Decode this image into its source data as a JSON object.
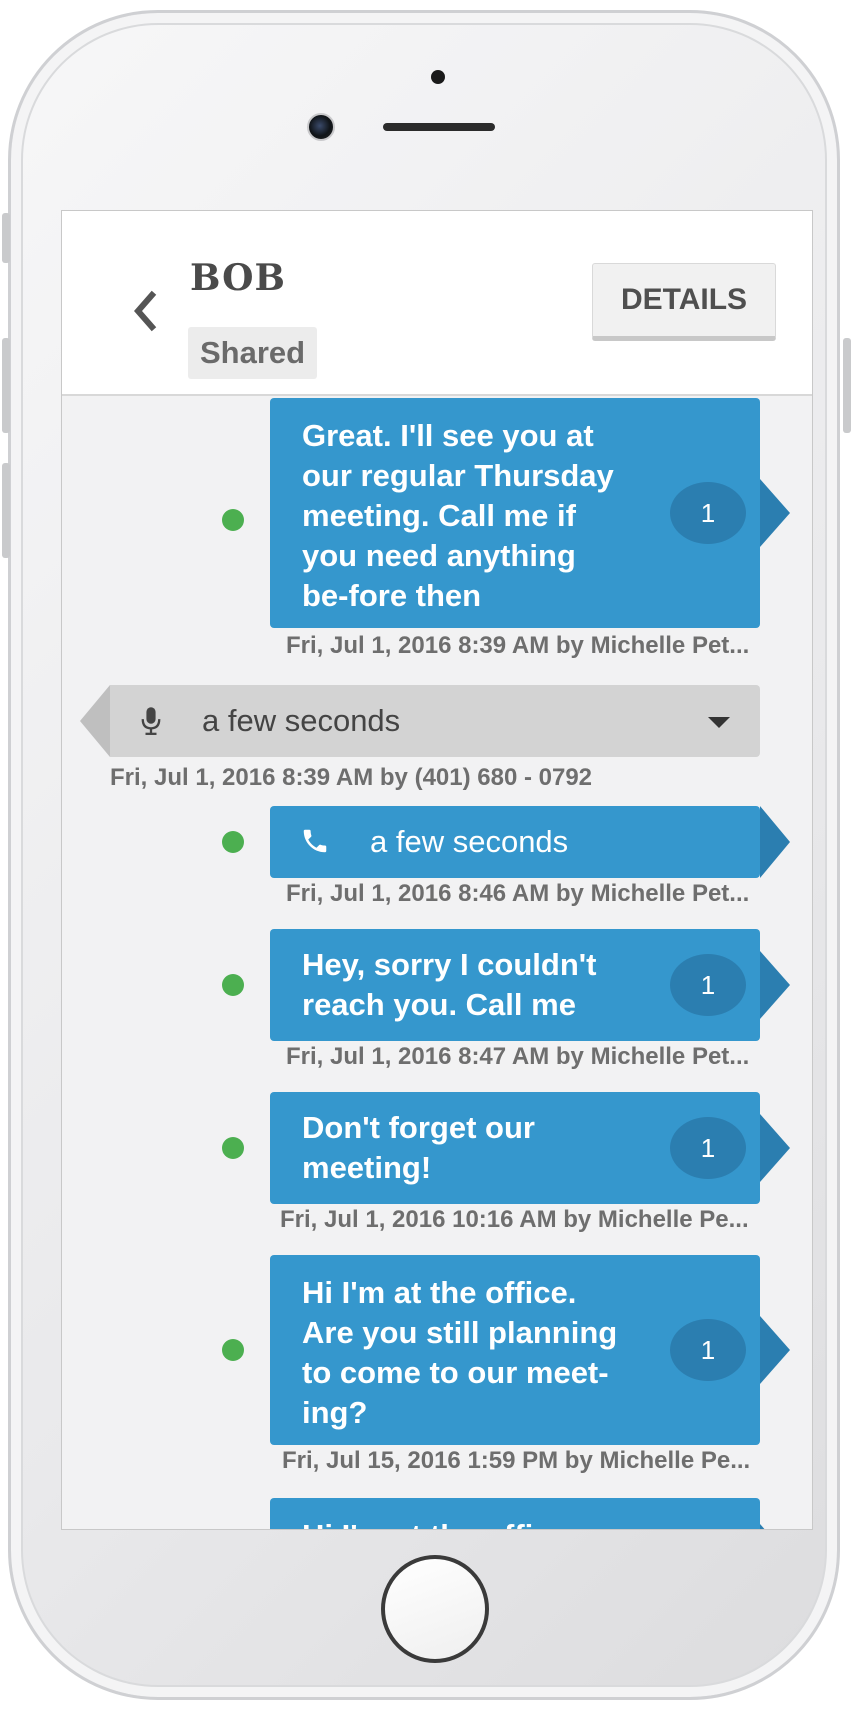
{
  "header": {
    "contact_name": "BOB",
    "badge": "Shared",
    "details_label": "DETAILS"
  },
  "messages": [
    {
      "text": "Great. I'll see you at our regular Thursday meeting. Call me if you need anything be-fore then",
      "count": "1",
      "meta": "Fri, Jul 1, 2016 8:39 AM by Michelle Pet..."
    },
    {
      "type": "voicemail",
      "label": "a few seconds",
      "meta": "Fri, Jul 1, 2016 8:39 AM by (401) 680 - 0792"
    },
    {
      "type": "call",
      "label": "a few seconds",
      "meta": "Fri, Jul 1, 2016 8:46 AM by Michelle Pet..."
    },
    {
      "text": "Hey, sorry I couldn't reach you. Call me",
      "count": "1",
      "meta": "Fri, Jul 1, 2016 8:47 AM by Michelle Pet..."
    },
    {
      "text": "Don't forget our meeting!",
      "count": "1",
      "meta": "Fri, Jul 1, 2016 10:16 AM by Michelle Pe..."
    },
    {
      "text": "Hi I'm at the office. Are you still planning to come to our meet-ing?",
      "count": "1",
      "meta": "Fri, Jul 15, 2016 1:59 PM by Michelle Pe..."
    },
    {
      "text": "Hi I'm at the office"
    }
  ],
  "icons": {
    "back": "chevron-left-icon",
    "microphone": "microphone-icon",
    "phone": "phone-icon",
    "dropdown": "caret-down-icon",
    "delivered": "status-dot-icon"
  },
  "colors": {
    "outgoing_bubble": "#3597cd",
    "bubble_accent": "#2b7eb0",
    "incoming_bubble": "#d3d3d3",
    "delivered_dot": "#4caf50"
  }
}
